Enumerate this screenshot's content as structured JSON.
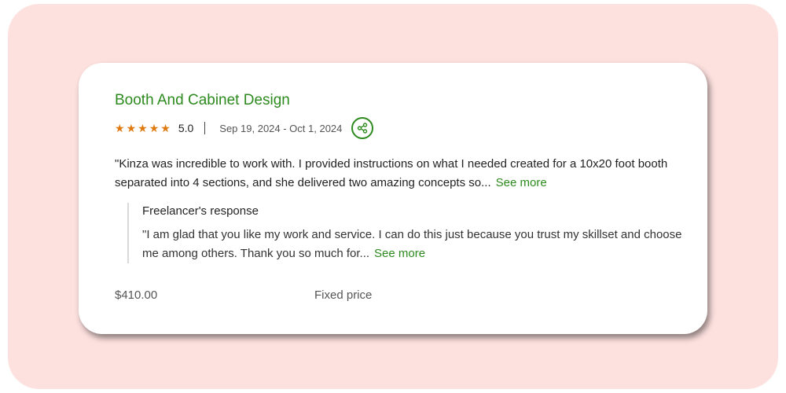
{
  "review": {
    "title": "Booth And Cabinet Design",
    "stars": [
      "★",
      "★",
      "★",
      "★",
      "★"
    ],
    "rating_value": 5,
    "rating": "5.0",
    "dates": "Sep 19, 2024 - Oct 1, 2024",
    "share_icon": "share-icon",
    "text": "\"Kinza was incredible to work with. I provided instructions on what I needed created for a 10x20 foot booth separated into 4 sections, and she delivered two amazing concepts so...",
    "see_more": "See more"
  },
  "response": {
    "title": "Freelancer's response",
    "text": "\"I am glad that you like my work and service. I can do this just because you trust my skillset and choose me among others. Thank you so much for...",
    "see_more": "See more"
  },
  "footer": {
    "price": "$410.00",
    "price_type": "Fixed price"
  },
  "colors": {
    "backdrop": "#fde1df",
    "accent_green": "#2d8a1e",
    "star_orange": "#e07a10"
  }
}
